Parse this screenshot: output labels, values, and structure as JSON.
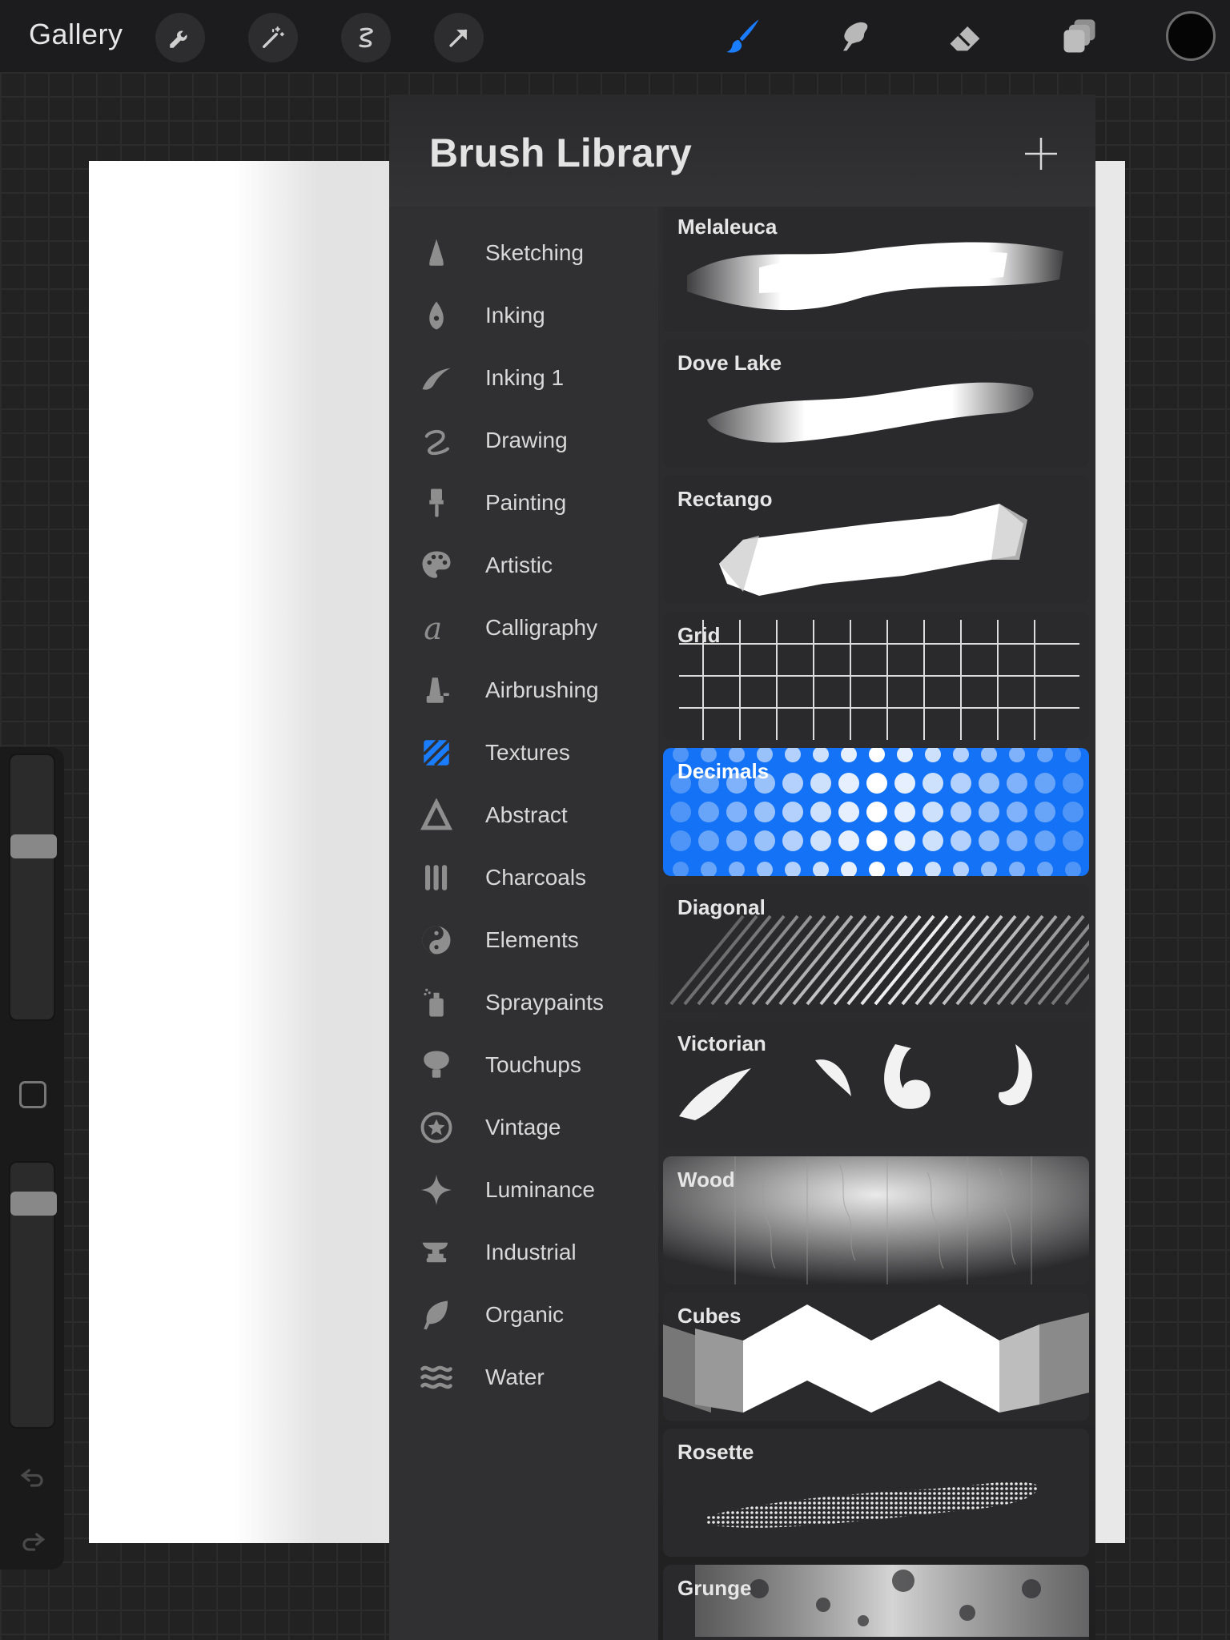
{
  "topbar": {
    "gallery_label": "Gallery",
    "left_tools": [
      "wrench-icon",
      "magic-wand-icon",
      "selection-icon",
      "transform-arrow-icon"
    ],
    "right_tools": [
      "brush-icon",
      "smudge-icon",
      "eraser-icon",
      "layers-icon"
    ],
    "active_tool": "brush-icon",
    "active_color": "#000000",
    "accent_color": "#1a7cff"
  },
  "sidebar": {
    "brush_size_level": 0.28,
    "opacity_level": 0.12
  },
  "panel": {
    "title": "Brush Library",
    "add_icon": "plus-icon"
  },
  "brush_sets": [
    {
      "label": "Sketching",
      "icon": "pencil-icon"
    },
    {
      "label": "Inking",
      "icon": "pen-nib-icon"
    },
    {
      "label": "Inking 1",
      "icon": "stroke-icon"
    },
    {
      "label": "Drawing",
      "icon": "squiggle-icon"
    },
    {
      "label": "Painting",
      "icon": "paintbrush-icon"
    },
    {
      "label": "Artistic",
      "icon": "palette-icon"
    },
    {
      "label": "Calligraphy",
      "icon": "calligraphy-icon"
    },
    {
      "label": "Airbrushing",
      "icon": "airbrush-icon"
    },
    {
      "label": "Textures",
      "icon": "texture-icon",
      "selected": true
    },
    {
      "label": "Abstract",
      "icon": "triangle-icon"
    },
    {
      "label": "Charcoals",
      "icon": "charcoal-icon"
    },
    {
      "label": "Elements",
      "icon": "yin-yang-icon"
    },
    {
      "label": "Spraypaints",
      "icon": "spray-can-icon"
    },
    {
      "label": "Touchups",
      "icon": "touchup-icon"
    },
    {
      "label": "Vintage",
      "icon": "star-badge-icon"
    },
    {
      "label": "Luminance",
      "icon": "sparkle-icon"
    },
    {
      "label": "Industrial",
      "icon": "anvil-icon"
    },
    {
      "label": "Organic",
      "icon": "leaf-icon"
    },
    {
      "label": "Water",
      "icon": "waves-icon"
    }
  ],
  "brushes": [
    {
      "name": "Melaleuca"
    },
    {
      "name": "Dove Lake"
    },
    {
      "name": "Rectango"
    },
    {
      "name": "Grid"
    },
    {
      "name": "Decimals",
      "selected": true
    },
    {
      "name": "Diagonal"
    },
    {
      "name": "Victorian"
    },
    {
      "name": "Wood"
    },
    {
      "name": "Cubes"
    },
    {
      "name": "Rosette"
    },
    {
      "name": "Grunge"
    }
  ]
}
